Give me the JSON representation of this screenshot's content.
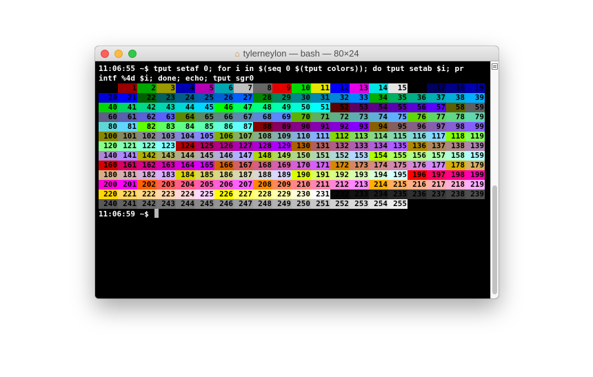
{
  "window": {
    "title": "tylerneylon — bash — 80×24",
    "title_icon": "house-icon"
  },
  "terminal": {
    "command_line_1": "11:06:55 ~$ tput setaf 0; for i in $(seq 0 $(tput colors)); do tput setab $i; pr",
    "command_line_2": "intf %4d $i; done; echo; tput sgr0",
    "prompt_line": "11:06:59 ~$ ",
    "colors": {
      "text": "#ffffff",
      "background": "#000000",
      "ansi16": [
        "#000000",
        "#990000",
        "#00a600",
        "#999900",
        "#0000b2",
        "#b200b2",
        "#00a6b2",
        "#bfbfbf",
        "#666666",
        "#e50000",
        "#00d900",
        "#e5e500",
        "#0000ff",
        "#e500e5",
        "#00e5e5",
        "#e5e5e5"
      ]
    },
    "color_table": {
      "first": 0,
      "last": 255,
      "columns": 20
    }
  },
  "scrollbar": {
    "menu_icon": "list-icon"
  }
}
